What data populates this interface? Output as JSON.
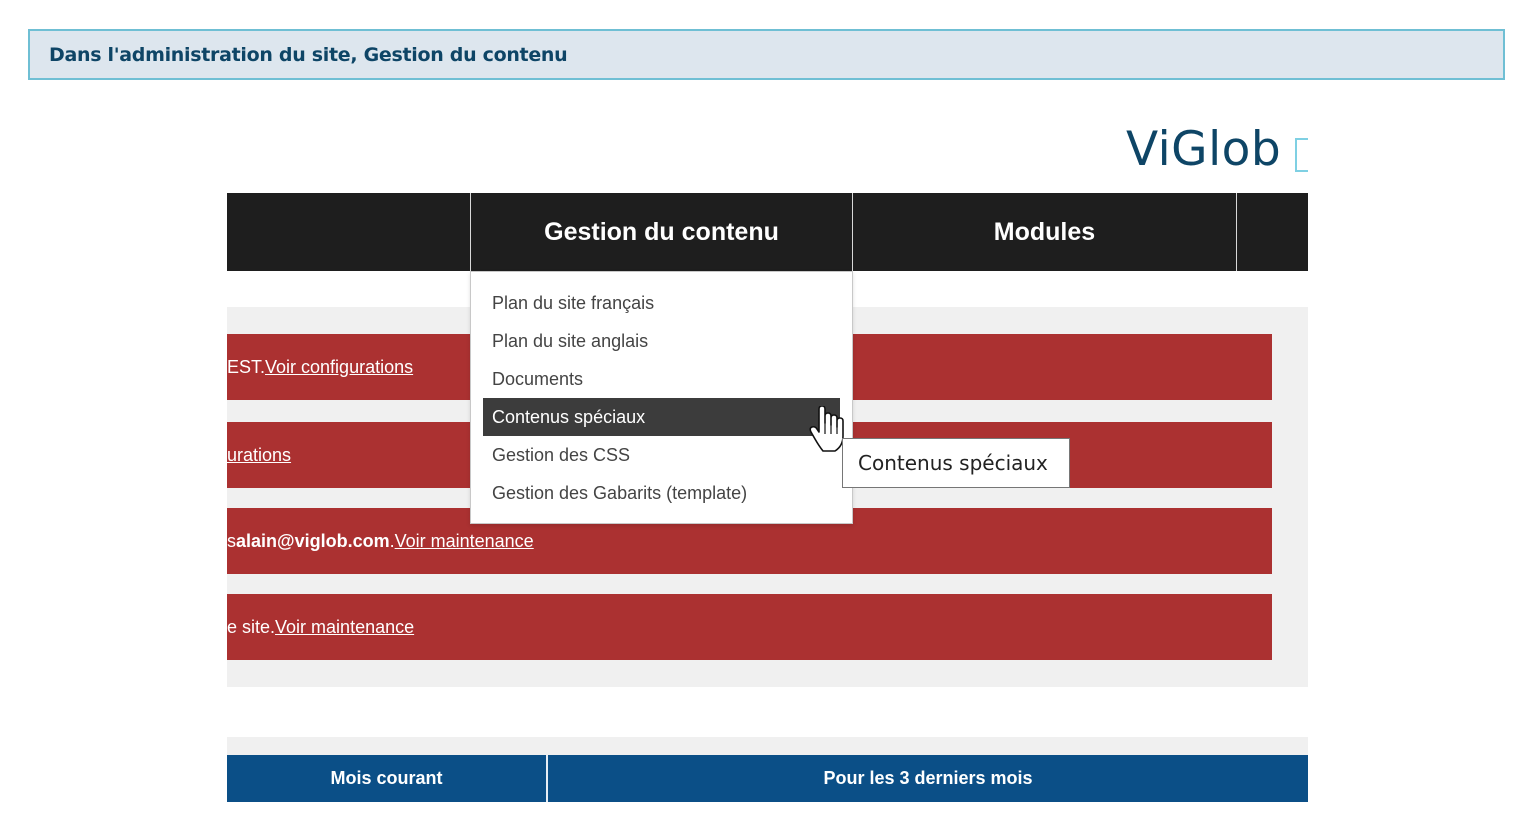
{
  "header": {
    "title": "Dans l'administration du site, Gestion du contenu"
  },
  "logo": {
    "text": "ViGlob"
  },
  "menubar": {
    "items": [
      "Gestion du contenu",
      "Modules"
    ]
  },
  "alerts": [
    {
      "prefix": "EST. ",
      "link": "Voir configurations"
    },
    {
      "prefix": "",
      "link": "urations"
    },
    {
      "prefix": "s ",
      "bold": "alain@viglob.com",
      "mid": ". ",
      "link": "Voir maintenance"
    },
    {
      "prefix": "e site. ",
      "link": "Voir maintenance"
    }
  ],
  "dropdown": {
    "items": [
      "Plan du site français",
      "Plan du site anglais",
      "Documents",
      "Contenus spéciaux",
      "Gestion des CSS",
      "Gestion des Gabarits (template)"
    ],
    "active_index": 3
  },
  "tooltip": {
    "text": "Contenus spéciaux"
  },
  "stats": {
    "col1": "Mois courant",
    "col2": "Pour les 3 derniers mois"
  },
  "colors": {
    "title_bg": "#dde6ee",
    "title_border": "#6fbfd4",
    "title_text": "#0e4566",
    "menubar_bg": "#1e1e1e",
    "alert_bg": "#ab3131",
    "stats_bg": "#0b4f87",
    "dropdown_active_bg": "#3c3c3c"
  }
}
